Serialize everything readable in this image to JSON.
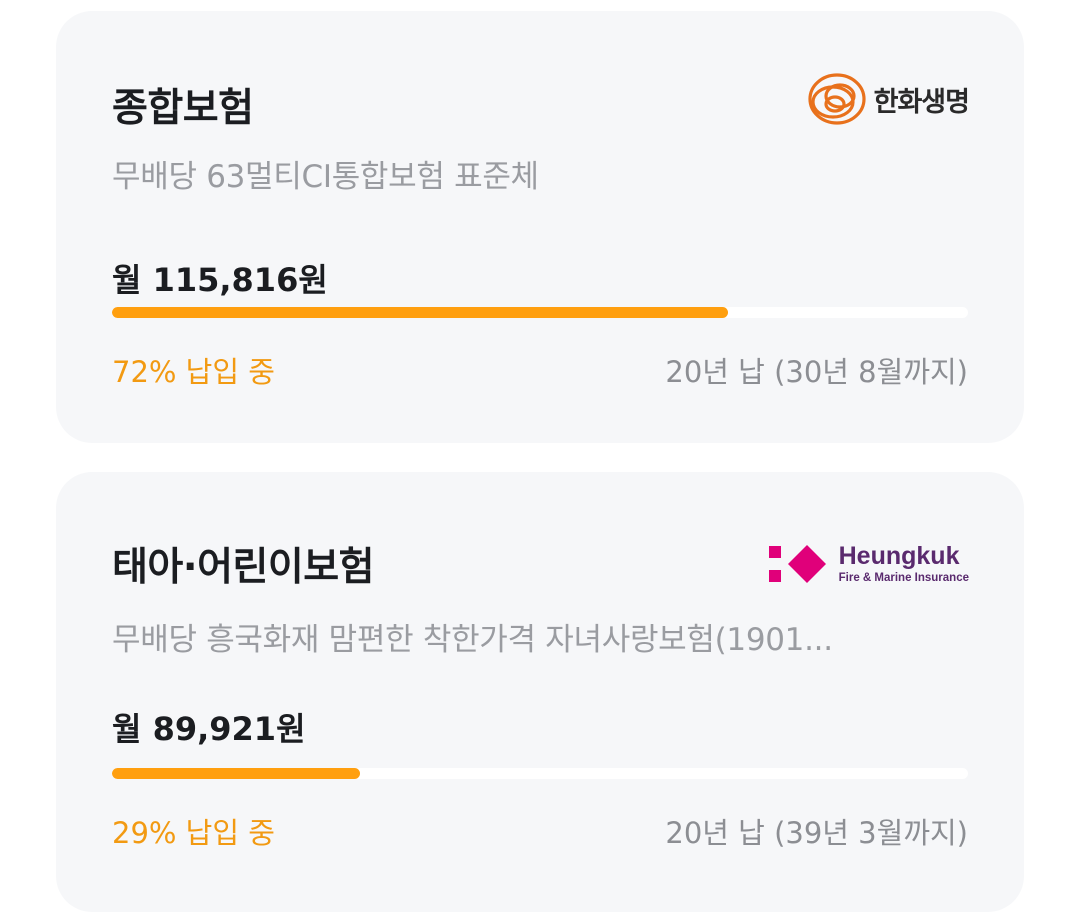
{
  "cards": [
    {
      "category": "종합보험",
      "product": "무배당 63멀티CI통합보험 표준체",
      "premium": "월 115,816원",
      "progress": 0.72,
      "status": "72% 납입 중",
      "term": "20년 납 (30년 8월까지)",
      "insurer": {
        "logo_text": "한화생명",
        "icon": "hanwha-logo-icon",
        "color": "#e8711c"
      }
    },
    {
      "category": "태아·어린이보험",
      "product": "무배당 흥국화재 맘편한 착한가격 자녀사랑보험(1901...",
      "premium": "월 89,921원",
      "progress": 0.29,
      "status": "29% 납입 중",
      "term": "20년 납 (39년 3월까지)",
      "insurer": {
        "logo_text": "Heungkuk",
        "logo_subtext": "Fire & Marine Insurance",
        "icon": "heungkuk-logo-icon",
        "color": "#e0007a"
      }
    }
  ],
  "colors": {
    "accent": "#ff9f0f",
    "status_text": "#f29a12",
    "card_background": "#f6f7f9"
  }
}
